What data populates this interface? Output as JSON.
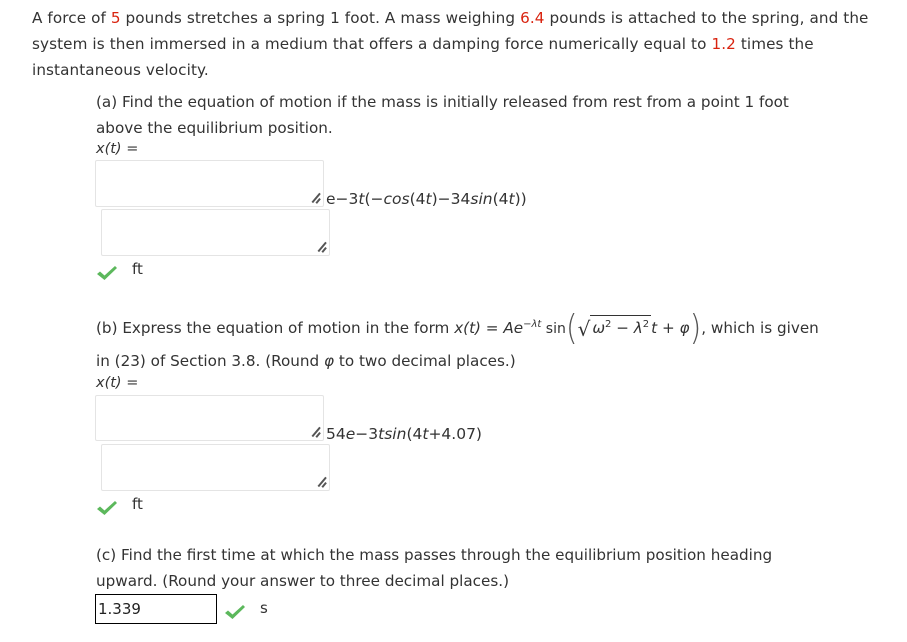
{
  "problem": {
    "intro_parts": [
      {
        "text": "A force of ",
        "highlight": false
      },
      {
        "text": "5",
        "highlight": true
      },
      {
        "text": " pounds stretches a spring 1 foot. A mass weighing ",
        "highlight": false
      },
      {
        "text": "6.4",
        "highlight": true
      },
      {
        "text": " pounds is attached to the spring, and the system is then immersed in a medium that offers a damping force numerically equal to ",
        "highlight": false
      },
      {
        "text": "1.2",
        "highlight": true
      },
      {
        "text": " times the instantaneous velocity.",
        "highlight": false
      }
    ],
    "highlight_color": "#d9230f"
  },
  "part_a": {
    "prompt_line1": "(a) Find the equation of motion if the mass is initially released from rest from a point 1 foot",
    "prompt_line2": "above the equilibrium position.",
    "lhs": "x(t)",
    "equals": " =",
    "textarea1_value": "",
    "textarea2_value": "",
    "rendered_answer": {
      "prefix": "e−3",
      "t1": "t",
      "mid1": "(−",
      "cos": "cos",
      "mid2": "(4",
      "t2": "t",
      "mid3": ")−34",
      "sin": "sin",
      "mid4": "(4",
      "t3": "t",
      "suffix": "))"
    },
    "status": "correct",
    "unit": "ft"
  },
  "part_b": {
    "prompt_start": "(b) Express the equation of motion in the form ",
    "formula": {
      "lhs": "x(t)",
      "eq": " = ",
      "A": "Ae",
      "exp": "−λt",
      "sin": " sin",
      "omega": "ω",
      "sq": "2",
      "minus": " − ",
      "lambda": "λ",
      "sq2": "2",
      "t": "t",
      "plus": " + ",
      "phi": "φ"
    },
    "prompt_end": ", which is given",
    "prompt_line2_a": "in (23) of Section 3.8. (Round ",
    "prompt_line2_phi": "φ",
    "prompt_line2_b": " to two decimal places.)",
    "lhs": "x(t)",
    "equals": " =",
    "textarea1_value": "",
    "textarea2_value": "",
    "rendered_answer": {
      "p1": "54",
      "e": "e",
      "p2": "−3",
      "t1": "tsin",
      "p3": "(4",
      "t2": "t",
      "p4": "+4.07)"
    },
    "status": "correct",
    "unit": "ft"
  },
  "part_c": {
    "prompt_line1": "(c) Find the first time at which the mass passes through the equilibrium position heading",
    "prompt_line2": "upward. (Round your answer to three decimal places.)",
    "answer_value": "1.339",
    "status": "correct",
    "unit": "s"
  },
  "check_color": "#5cb85c"
}
